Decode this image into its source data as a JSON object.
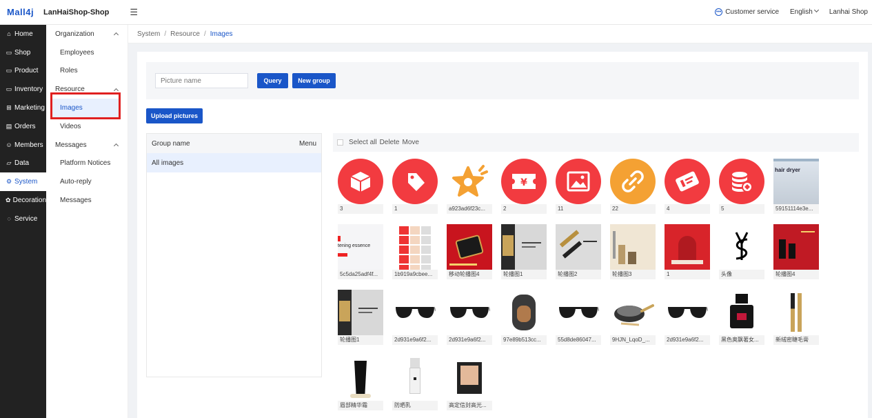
{
  "header": {
    "logo": "Mall4j",
    "shop_name": "LanHaiShop-Shop",
    "customer_service": "Customer service",
    "language": "English",
    "user": "Lanhai Shop"
  },
  "sidebar": {
    "items": [
      {
        "label": "Home",
        "icon": "home-icon"
      },
      {
        "label": "Shop",
        "icon": "shop-icon"
      },
      {
        "label": "Product",
        "icon": "product-icon"
      },
      {
        "label": "Inventory",
        "icon": "inventory-icon"
      },
      {
        "label": "Marketing",
        "icon": "gift-icon"
      },
      {
        "label": "Orders",
        "icon": "orders-icon"
      },
      {
        "label": "Members",
        "icon": "members-icon"
      },
      {
        "label": "Data",
        "icon": "data-icon"
      },
      {
        "label": "System",
        "icon": "gear-icon"
      },
      {
        "label": "Decoration",
        "icon": "decoration-icon"
      },
      {
        "label": "Service",
        "icon": "chat-icon"
      }
    ],
    "active_index": 8
  },
  "submenu": {
    "organization": "Organization",
    "employees": "Employees",
    "roles": "Roles",
    "resource": "Resource",
    "images": "Images",
    "videos": "Videos",
    "messages_group": "Messages",
    "platform_notices": "Platform Notices",
    "auto_reply": "Auto-reply",
    "messages": "Messages"
  },
  "breadcrumb": {
    "items": [
      "System",
      "Resource",
      "Images"
    ]
  },
  "search": {
    "placeholder": "Picture name",
    "query": "Query",
    "new_group": "New group",
    "upload": "Upload pictures"
  },
  "groups": {
    "header": "Group name",
    "menu": "Menu",
    "rows": [
      "All images"
    ]
  },
  "toolbar": {
    "select_all": "Select all",
    "delete": "Delete",
    "move": "Move"
  },
  "images": [
    {
      "caption": "3",
      "kind": "box-icon",
      "color": "#f23b40"
    },
    {
      "caption": "1",
      "kind": "tag-icon",
      "color": "#f23b40"
    },
    {
      "caption": "a923ad6f23c...",
      "kind": "star-icon",
      "color": "#f4a133"
    },
    {
      "caption": "2",
      "kind": "ticket-icon",
      "color": "#f23b40"
    },
    {
      "caption": "11",
      "kind": "picture-icon",
      "color": "#f23b40"
    },
    {
      "caption": "22",
      "kind": "link-icon",
      "color": "#f4a133"
    },
    {
      "caption": "4",
      "kind": "coupon-icon",
      "color": "#f23b40"
    },
    {
      "caption": "5",
      "kind": "coins-icon",
      "color": "#f23b40"
    },
    {
      "caption": "59151114e3e...",
      "kind": "banner-hair-dryer",
      "text": "hair dryer"
    },
    {
      "caption": "5c5da25adf4f...",
      "kind": "banner-essence",
      "text": "tening essence"
    },
    {
      "caption": "1b919a9cbee...",
      "kind": "product-collage"
    },
    {
      "caption": "移动轮播图4",
      "kind": "red-gift-box"
    },
    {
      "caption": "轮播图1",
      "kind": "dark-banner"
    },
    {
      "caption": "轮播图2",
      "kind": "gold-banner"
    },
    {
      "caption": "轮播图3",
      "kind": "beige-banner"
    },
    {
      "caption": "1",
      "kind": "red-stage"
    },
    {
      "caption": "头像",
      "kind": "ysl-logo"
    },
    {
      "caption": "轮播图4",
      "kind": "red-lipstick"
    },
    {
      "caption": "轮播图1",
      "kind": "dark-banner"
    },
    {
      "caption": "2d931e9a6f2...",
      "kind": "sunglasses"
    },
    {
      "caption": "2d931e9a6f2...",
      "kind": "sunglasses"
    },
    {
      "caption": "97e89b513cc...",
      "kind": "pet-carrier"
    },
    {
      "caption": "55d8de86047...",
      "kind": "sunglasses"
    },
    {
      "caption": "9HJN_LqoD_...",
      "kind": "wok"
    },
    {
      "caption": "2d931e9a6f2...",
      "kind": "sunglasses"
    },
    {
      "caption": "黑色奥飘著女...",
      "kind": "perfume"
    },
    {
      "caption": "新绒密睫毛膏",
      "kind": "mascara"
    },
    {
      "caption": "眉部精华霜",
      "kind": "black-tube"
    },
    {
      "caption": "防晒乳",
      "kind": "white-bottle"
    },
    {
      "caption": "高定信封高光...",
      "kind": "compact"
    }
  ]
}
